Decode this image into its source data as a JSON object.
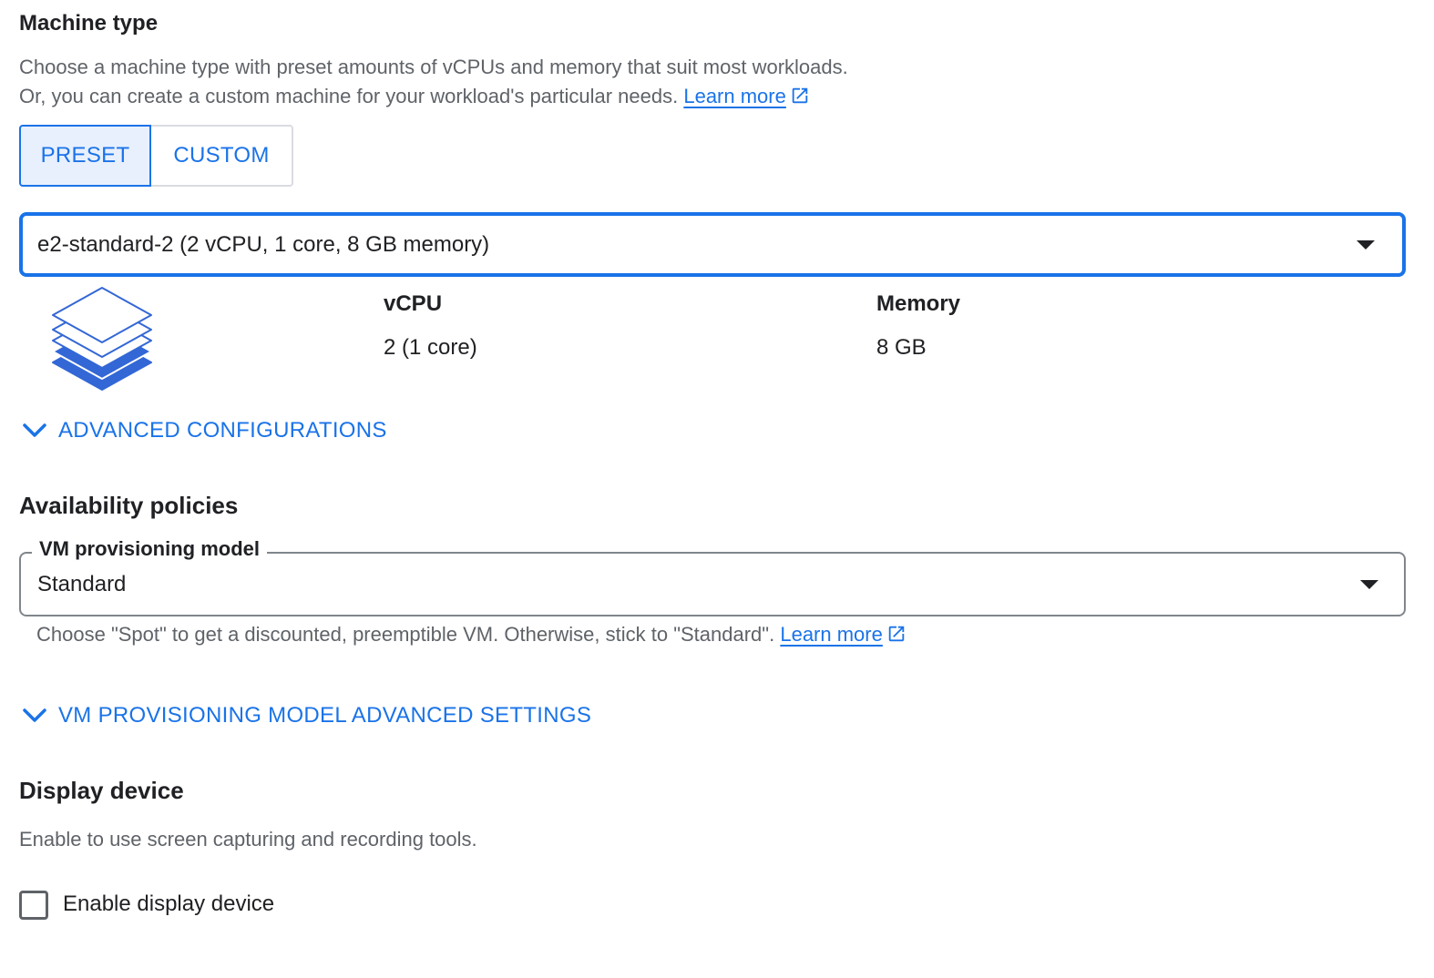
{
  "machine_type": {
    "title": "Machine type",
    "description_line1": "Choose a machine type with preset amounts of vCPUs and memory that suit most workloads.",
    "description_line2": "Or, you can create a custom machine for your workload's particular needs.",
    "learn_more": "Learn more",
    "toggle": {
      "preset_label": "PRESET",
      "custom_label": "CUSTOM",
      "selected": "PRESET"
    },
    "select_value": "e2-standard-2 (2 vCPU, 1 core, 8 GB memory)",
    "specs": {
      "vcpu_label": "vCPU",
      "vcpu_value": "2 (1 core)",
      "memory_label": "Memory",
      "memory_value": "8 GB"
    },
    "advanced_label": "ADVANCED CONFIGURATIONS"
  },
  "availability": {
    "title": "Availability policies",
    "provisioning_label": "VM provisioning model",
    "provisioning_value": "Standard",
    "hint": "Choose \"Spot\" to get a discounted, preemptible VM. Otherwise, stick to \"Standard\".",
    "learn_more": "Learn more",
    "advanced_label": "VM PROVISIONING MODEL ADVANCED SETTINGS"
  },
  "display_device": {
    "title": "Display device",
    "description": "Enable to use screen capturing and recording tools.",
    "checkbox_label": "Enable display device",
    "checked": false
  },
  "icons": {
    "external_link": "external-link-icon",
    "chevron": "chevron-down-icon",
    "dropdown": "dropdown-caret-icon",
    "machine": "machine-stack-icon"
  },
  "colors": {
    "accent": "#1a73e8",
    "toggle_selected_bg": "#e8f0fe",
    "secondary_text": "#5f6368"
  }
}
